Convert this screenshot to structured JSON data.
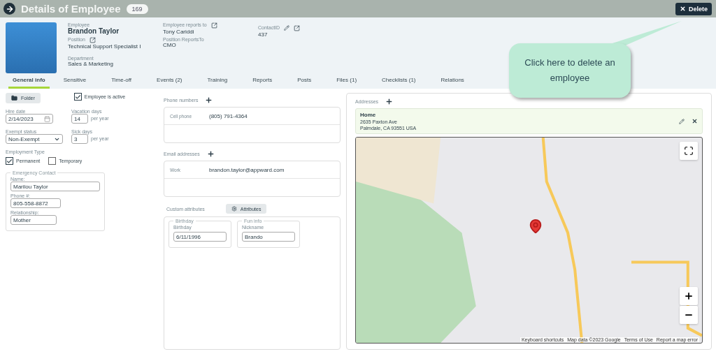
{
  "header": {
    "title": "Details of Employee",
    "count": "169",
    "delete_label": "Delete"
  },
  "profile": {
    "employee": {
      "label": "Employee",
      "value": "Brandon Taylor"
    },
    "position": {
      "label": "Position",
      "value": "Technical Support Specialist I"
    },
    "department": {
      "label": "Department",
      "value": "Sales & Marketing"
    },
    "reports_to": {
      "label": "Employee reports to",
      "value": "Tony Cariddi"
    },
    "position_reports_to": {
      "label": "Position ReportsTo",
      "value": "CMO"
    },
    "contact_id": {
      "label": "ContactID",
      "value": "437"
    }
  },
  "tabs": [
    {
      "label": "General info",
      "selected": true
    },
    {
      "label": "Sensitive",
      "selected": false
    },
    {
      "label": "Time-off",
      "selected": false
    },
    {
      "label": "Events (2)",
      "selected": false
    },
    {
      "label": "Training",
      "selected": false
    },
    {
      "label": "Reports",
      "selected": false
    },
    {
      "label": "Posts",
      "selected": false
    },
    {
      "label": "Files (1)",
      "selected": false
    },
    {
      "label": "Checklists (1)",
      "selected": false
    },
    {
      "label": "Relations",
      "selected": false
    }
  ],
  "general": {
    "folder_button": "Folder",
    "employee_active": {
      "label": "Employee is active",
      "checked": true
    },
    "hire_date": {
      "label": "Hire date",
      "value": "2/14/2023"
    },
    "vacation_days": {
      "label": "Vacation days",
      "value": "14",
      "unit": "per year"
    },
    "exempt_status": {
      "label": "Exempt status",
      "value": "Non-Exempt"
    },
    "sick_days": {
      "label": "Sick days",
      "value": "3",
      "unit": "per year"
    },
    "employment_type": {
      "label": "Employment Type",
      "options": [
        {
          "label": "Permanent",
          "checked": true
        },
        {
          "label": "Temporary",
          "checked": false
        }
      ]
    },
    "emergency_contact": {
      "legend": "Emergency Contact",
      "fields": [
        {
          "label": "Name:",
          "value": "Marilou Taylor"
        },
        {
          "label": "Phone #:",
          "value": "805-558-8872"
        },
        {
          "label": "Relationship:",
          "value": "Mother"
        }
      ]
    }
  },
  "phone_numbers": {
    "label": "Phone numbers",
    "rows": [
      {
        "type": "Cell phone",
        "value": "(805) 791-4364"
      }
    ]
  },
  "email_addresses": {
    "label": "Email addresses",
    "rows": [
      {
        "type": "Work",
        "value": "brandon.taylor@appward.com"
      }
    ]
  },
  "custom_attributes": {
    "label": "Custom attributes",
    "button": "Attributes",
    "groups": [
      {
        "legend": "Birthday",
        "field_label": "Birthday",
        "value": "6/11/1996"
      },
      {
        "legend": "Fun info",
        "field_label": "Nickname",
        "value": "Brando"
      }
    ]
  },
  "addresses": {
    "label": "Addresses",
    "items": [
      {
        "name": "Home",
        "line1": "2635 Paxton Ave",
        "line2": "Palmdale, CA 93551 USA"
      }
    ]
  },
  "map": {
    "attribution": [
      "Keyboard shortcuts",
      "Map data ©2023 Google",
      "Terms of Use",
      "Report a map error"
    ]
  },
  "callout": {
    "text": "Click here to delete an employee"
  }
}
